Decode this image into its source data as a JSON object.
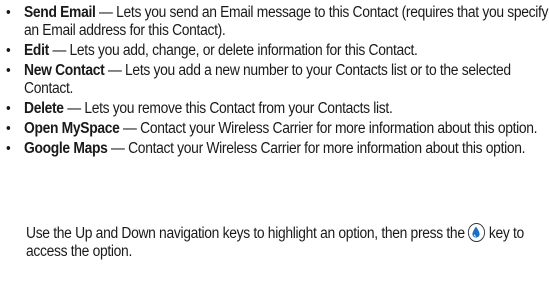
{
  "items": [
    {
      "term": "Send Email",
      "dash": " — ",
      "desc": "Lets you send an Email message to this Contact (requires that you specify an Email address for this Contact)."
    },
    {
      "term": "Edit",
      "dash": " — ",
      "desc": "Lets you add, change, or delete information for this Contact."
    },
    {
      "term": "New Contact",
      "dash": " — ",
      "desc": "Lets you add a new number to your Contacts list or to the selected Contact."
    },
    {
      "term": "Delete",
      "dash": " — ",
      "desc": "Lets you remove this Contact from your Contacts list."
    },
    {
      "term": "Open MySpace",
      "dash": " — ",
      "desc": "Contact your Wireless Carrier for more information about this option."
    },
    {
      "term": "Google Maps",
      "dash": " — ",
      "desc": "Contact your Wireless Carrier for more information about this option."
    }
  ],
  "bullet_char": "•",
  "instruction": {
    "before_key": "Use the Up and Down navigation keys to highlight an option, then press the ",
    "key_icon": "ok-key-icon",
    "after_key": " key to access the option."
  }
}
